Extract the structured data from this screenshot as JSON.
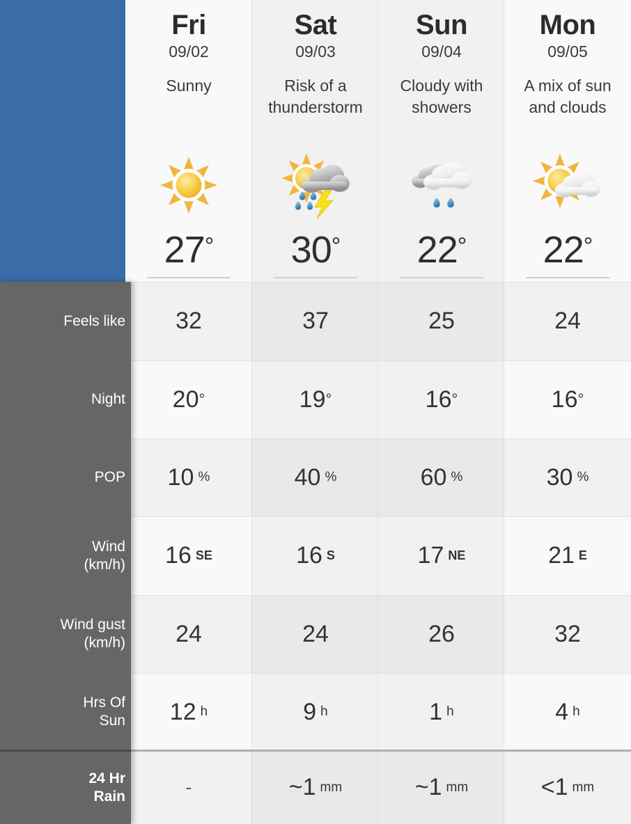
{
  "panel": {
    "accent_color": "#3a6ca8",
    "sidebar_color": "#666666"
  },
  "days": [
    {
      "name": "Fri",
      "date": "09/02",
      "desc": "Sunny",
      "icon": "sun-icon",
      "high": "27",
      "deg": "°"
    },
    {
      "name": "Sat",
      "date": "09/03",
      "desc": "Risk of a thunderstorm",
      "icon": "sun-cloud-rain-thunder-icon",
      "high": "30",
      "deg": "°"
    },
    {
      "name": "Sun",
      "date": "09/04",
      "desc": "Cloudy with showers",
      "icon": "cloud-rain-icon",
      "high": "22",
      "deg": "°"
    },
    {
      "name": "Mon",
      "date": "09/05",
      "desc": "A mix of sun and clouds",
      "icon": "sun-cloud-icon",
      "high": "22",
      "deg": "°"
    }
  ],
  "rows": [
    {
      "label": "Feels like",
      "label_lines": [
        "Feels like"
      ],
      "bold": false,
      "values": [
        "32",
        "37",
        "25",
        "24"
      ],
      "units": [
        "",
        "",
        "",
        ""
      ]
    },
    {
      "label": "Night",
      "label_lines": [
        "Night"
      ],
      "bold": false,
      "values": [
        "20",
        "19",
        "16",
        "16"
      ],
      "units": [
        "°",
        "°",
        "°",
        "°"
      ]
    },
    {
      "label": "POP",
      "label_lines": [
        "POP"
      ],
      "bold": false,
      "values": [
        "10",
        "40",
        "60",
        "30"
      ],
      "units": [
        "%",
        "%",
        "%",
        "%"
      ]
    },
    {
      "label": "Wind (km/h)",
      "label_lines": [
        "Wind",
        "(km/h)"
      ],
      "bold": false,
      "values": [
        "16",
        "16",
        "17",
        "21"
      ],
      "units": [
        "SE",
        "S",
        "NE",
        "E"
      ]
    },
    {
      "label": "Wind gust (km/h)",
      "label_lines": [
        "Wind gust",
        "(km/h)"
      ],
      "bold": false,
      "values": [
        "24",
        "24",
        "26",
        "32"
      ],
      "units": [
        "",
        "",
        "",
        ""
      ]
    },
    {
      "label": "Hrs Of Sun",
      "label_lines": [
        "Hrs Of",
        "Sun"
      ],
      "bold": false,
      "values": [
        "12",
        "9",
        "1",
        "4"
      ],
      "units": [
        "h",
        "h",
        "h",
        "h"
      ]
    },
    {
      "label": "24 Hr Rain",
      "label_lines": [
        "24 Hr",
        "Rain"
      ],
      "bold": true,
      "values": [
        "-",
        "~1",
        "~1",
        "<1"
      ],
      "units": [
        "",
        "mm",
        "mm",
        "mm"
      ]
    }
  ]
}
